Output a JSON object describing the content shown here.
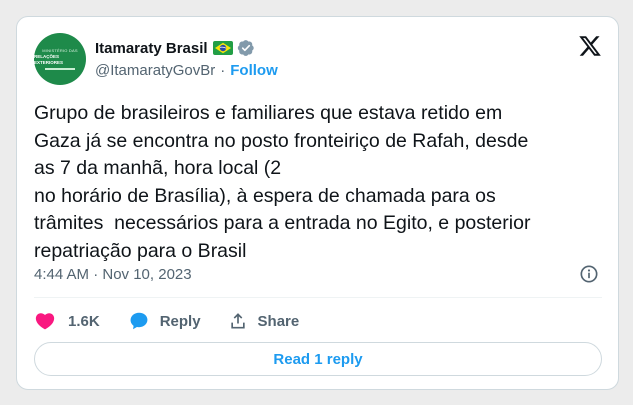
{
  "author": {
    "display_name": "Itamaraty Brasil",
    "handle": "@ItamaratyGovBr",
    "follow_label": "Follow",
    "separator": "·",
    "avatar_text": {
      "line1": "MINISTÉRIO DAS",
      "line2": "RELAÇÕES EXTERIORES"
    },
    "flag_icon": "brazil-flag-icon",
    "verified_icon": "gray-verified-badge-icon"
  },
  "tweet": {
    "text": "Grupo de brasileiros e familiares que estava retido em\nGaza já se encontra no posto fronteiriço de Rafah, desde\nas 7 da manhã, hora local (2\nno horário de Brasília), à espera de chamada para os\ntrâmites  necessários para a entrada no Egito, e posterior\nrepatriação para o Brasil",
    "timestamp": "4:44 AM · Nov 10, 2023"
  },
  "actions": {
    "likes_count": "1.6K",
    "reply_label": "Reply",
    "share_label": "Share",
    "read_replies_label": "Read 1 reply"
  },
  "icons": {
    "logo": "x-logo-icon",
    "info": "info-icon",
    "like": "heart-icon",
    "reply": "speech-bubble-icon",
    "share": "share-icon"
  },
  "colors": {
    "accent": "#1d9bf0",
    "like": "#f91880",
    "text_primary": "#0f1419",
    "text_secondary": "#536471",
    "border": "#cfd9de",
    "avatar_bg": "#1e8a4a"
  }
}
